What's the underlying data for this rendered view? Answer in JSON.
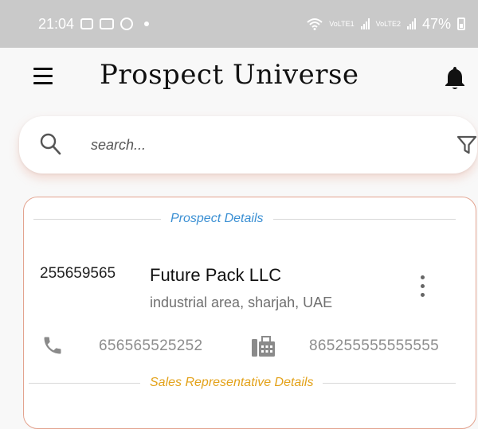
{
  "status_bar": {
    "time": "21:04",
    "signal_label_1": "VoLTE1",
    "signal_label_2": "VoLTE2",
    "battery": "47%"
  },
  "header": {
    "title": "Prospect Universe",
    "icons": [
      "menu-icon",
      "bell-icon"
    ]
  },
  "search": {
    "placeholder": "search...",
    "value": "",
    "icons": [
      "search-icon",
      "filter-icon"
    ]
  },
  "prospect_card": {
    "section_title": "Prospect Details",
    "id": "255659565",
    "company_name": "Future Pack LLC",
    "address": "industrial area, sharjah, UAE",
    "phone": "656565525252",
    "fax": "865255555555555",
    "sales_section_title": "Sales Representative Details"
  },
  "colors": {
    "status_bar": "#c9c9c9",
    "prospect_section": "#3a8fd3",
    "sales_section": "#e3a21a",
    "card_border": "#e3a38f"
  }
}
